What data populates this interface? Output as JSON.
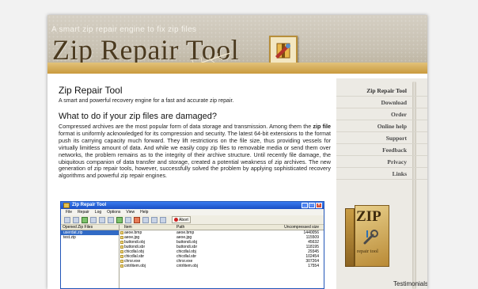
{
  "header": {
    "tagline": "A smart zip repair engine to fix zip files",
    "title": "Zip Repair Tool"
  },
  "content": {
    "heading": "Zip Repair Tool",
    "tagline": "A smart and powerful recovery engine for a fast and accurate zip repair.",
    "question": "What to do if your zip files are damaged?",
    "paragraph_start": "Compressed archives are the most popular form of data storage and transmission. Among them the ",
    "paragraph_bold": "zip file",
    "paragraph_end": " format is uniformly acknowledged for its compression and security. The latest 64-bit extensions to the format push its carrying capacity much forward. They lift restrictions on the file size, thus providing vessels for virtually limitless amount of data. And while we easily copy zip files to removable media or send them over networks, the problem remains as to the integrity of their archive structure. Until recently file damage, the ubiquitous companion of data transfer and storage, created a potential weakness of zip archives. The new generation of zip repair tools, however, successfully solved the problem by applying sophisticated recovery algorithms and powerful zip repair engines."
  },
  "app_window": {
    "title": "Zip Repair Tool",
    "menu": [
      "File",
      "Repair",
      "Log",
      "Options",
      "View",
      "Help"
    ],
    "abort_label": "Abort",
    "left_header": "Opened Zip Files",
    "opened_files": [
      {
        "name": "userdat.zip",
        "selected": true
      },
      {
        "name": "test.zip",
        "selected": false
      }
    ],
    "columns": [
      "Item",
      "Path",
      "Uncompressed size"
    ],
    "rows": [
      {
        "item": "aeoe.bmp",
        "path": "aeoe.bmp",
        "size": "1440056"
      },
      {
        "item": "aeoe.jpg",
        "path": "aeoe.jpg",
        "size": "115509"
      },
      {
        "item": "buttondi.obj",
        "path": "buttondi.obj",
        "size": "45632"
      },
      {
        "item": "buttondi.sbr",
        "path": "buttondi.sbr",
        "size": "118195"
      },
      {
        "item": "chicdlal.obj",
        "path": "chicdlal.obj",
        "size": "29345"
      },
      {
        "item": "chicdlal.sbr",
        "path": "chicdlal.sbr",
        "size": "102454"
      },
      {
        "item": "chrsr.exe",
        "path": "chrsr.exe",
        "size": "307264"
      },
      {
        "item": "cntrlitem.obj",
        "path": "cntrlitem.obj",
        "size": "17554"
      }
    ]
  },
  "sidebar": {
    "nav": [
      "Zip Repair Tool",
      "Download",
      "Order",
      "Online help",
      "Support",
      "Feedback",
      "Privacy",
      "Links"
    ],
    "box_title": "ZIP",
    "box_subtitle": "repair tool",
    "testimonials": "Testimonials"
  },
  "colors": {
    "header_bar": "#d4aa55",
    "title_text": "#4b3a1f",
    "sidebar_bg": "#eceae4",
    "window_titlebar": "#2a62d8"
  }
}
